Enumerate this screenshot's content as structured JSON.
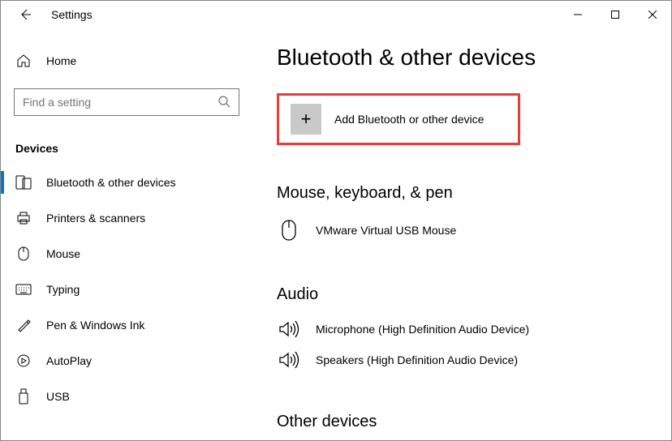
{
  "window": {
    "title": "Settings"
  },
  "nav": {
    "home_label": "Home",
    "search_placeholder": "Find a setting",
    "section_label": "Devices",
    "items": [
      {
        "label": "Bluetooth & other devices"
      },
      {
        "label": "Printers & scanners"
      },
      {
        "label": "Mouse"
      },
      {
        "label": "Typing"
      },
      {
        "label": "Pen & Windows Ink"
      },
      {
        "label": "AutoPlay"
      },
      {
        "label": "USB"
      }
    ]
  },
  "main": {
    "title": "Bluetooth & other devices",
    "add_device_label": "Add Bluetooth or other device",
    "sections": {
      "mkp": {
        "heading": "Mouse, keyboard, & pen",
        "items": [
          {
            "label": "VMware Virtual USB Mouse"
          }
        ]
      },
      "audio": {
        "heading": "Audio",
        "items": [
          {
            "label": "Microphone (High Definition Audio Device)"
          },
          {
            "label": "Speakers (High Definition Audio Device)"
          }
        ]
      },
      "other": {
        "heading": "Other devices"
      }
    }
  }
}
